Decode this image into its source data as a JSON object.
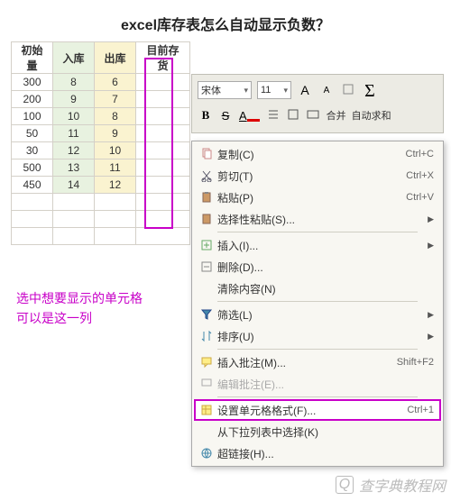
{
  "title": "excel库存表怎么自动显示负数？",
  "headers": {
    "a": "初始量",
    "b": "入库",
    "c": "出库",
    "d": "目前存货"
  },
  "rows": [
    {
      "a": "300",
      "b": "8",
      "c": "6"
    },
    {
      "a": "200",
      "b": "9",
      "c": "7"
    },
    {
      "a": "100",
      "b": "10",
      "c": "8"
    },
    {
      "a": "50",
      "b": "11",
      "c": "9"
    },
    {
      "a": "30",
      "b": "12",
      "c": "10"
    },
    {
      "a": "500",
      "b": "13",
      "c": "11"
    },
    {
      "a": "450",
      "b": "14",
      "c": "12"
    }
  ],
  "annotation": {
    "line1": "选中想要显示的单元格",
    "line2": "可以是这一列"
  },
  "toolbar": {
    "font": "宋体",
    "size": "11",
    "aplus": "A",
    "aminus": "A",
    "bold": "B",
    "strike": "S",
    "underline": "A",
    "merge": "合并",
    "autosum": "自动求和"
  },
  "menu": [
    {
      "icon": "copy",
      "label": "复制(C)",
      "shortcut": "Ctrl+C"
    },
    {
      "icon": "cut",
      "label": "剪切(T)",
      "shortcut": "Ctrl+X"
    },
    {
      "icon": "paste",
      "label": "粘贴(P)",
      "shortcut": "Ctrl+V"
    },
    {
      "icon": "pastesp",
      "label": "选择性粘贴(S)...",
      "sub": true
    },
    {
      "sep": true
    },
    {
      "icon": "insert",
      "label": "插入(I)...",
      "sub": true
    },
    {
      "icon": "delete",
      "label": "删除(D)..."
    },
    {
      "icon": "clear",
      "label": "清除内容(N)"
    },
    {
      "sep": true
    },
    {
      "icon": "filter",
      "label": "筛选(L)",
      "sub": true
    },
    {
      "icon": "sort",
      "label": "排序(U)",
      "sub": true
    },
    {
      "sep": true
    },
    {
      "icon": "comment",
      "label": "插入批注(M)...",
      "shortcut": "Shift+F2"
    },
    {
      "icon": "editc",
      "label": "编辑批注(E)...",
      "disabled": true
    },
    {
      "sep": true
    },
    {
      "icon": "format",
      "label": "设置单元格格式(F)...",
      "shortcut": "Ctrl+1",
      "highlight": true
    },
    {
      "icon": "pick",
      "label": "从下拉列表中选择(K)"
    },
    {
      "icon": "link",
      "label": "超链接(H)..."
    }
  ],
  "watermark": "查字典教程网"
}
